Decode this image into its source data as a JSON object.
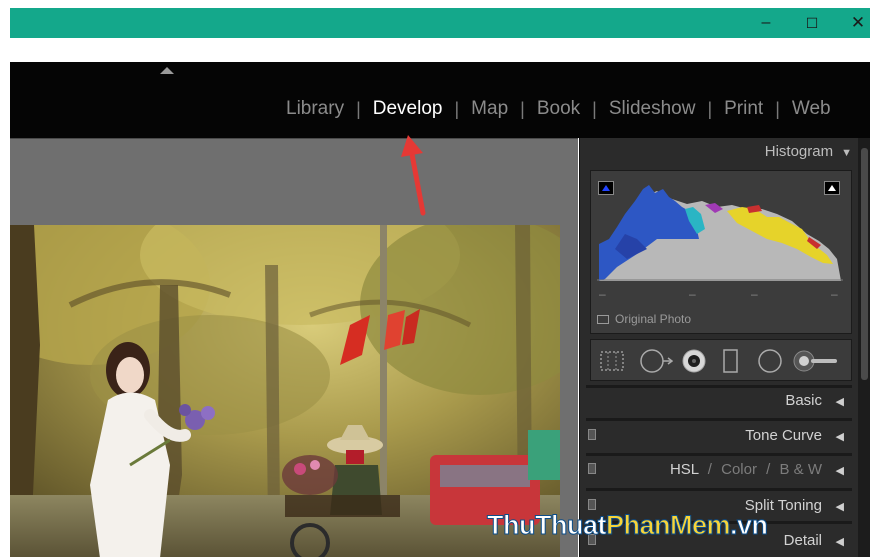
{
  "window": {
    "minimize_glyph": "–",
    "maximize_glyph": "☐",
    "close_glyph": "✕",
    "accent_color": "#14a88b"
  },
  "modules": {
    "items": [
      {
        "label": "Library",
        "active": false
      },
      {
        "label": "Develop",
        "active": true
      },
      {
        "label": "Map",
        "active": false
      },
      {
        "label": "Book",
        "active": false
      },
      {
        "label": "Slideshow",
        "active": false
      },
      {
        "label": "Print",
        "active": false
      },
      {
        "label": "Web",
        "active": false
      }
    ],
    "separator": "|"
  },
  "histogram": {
    "title": "Histogram",
    "collapse_glyph": "▼",
    "original_photo_label": "Original Photo",
    "dash": "–"
  },
  "tools": [
    "crop-overlay-icon",
    "spot-removal-icon",
    "red-eye-icon",
    "graduated-filter-icon",
    "radial-filter-icon",
    "adjustment-brush-icon"
  ],
  "panels": {
    "basic": "Basic",
    "tone_curve": "Tone Curve",
    "hsl": {
      "hsl": "HSL",
      "slash": "/",
      "color": "Color",
      "bw": "B & W"
    },
    "split_toning": "Split Toning",
    "detail": "Detail",
    "expand_glyph": "◀"
  },
  "watermark": {
    "part1": "ThuThuat",
    "part2": "PhanMem",
    "part3": ".vn"
  },
  "colors": {
    "annotation_arrow": "#e53935"
  }
}
